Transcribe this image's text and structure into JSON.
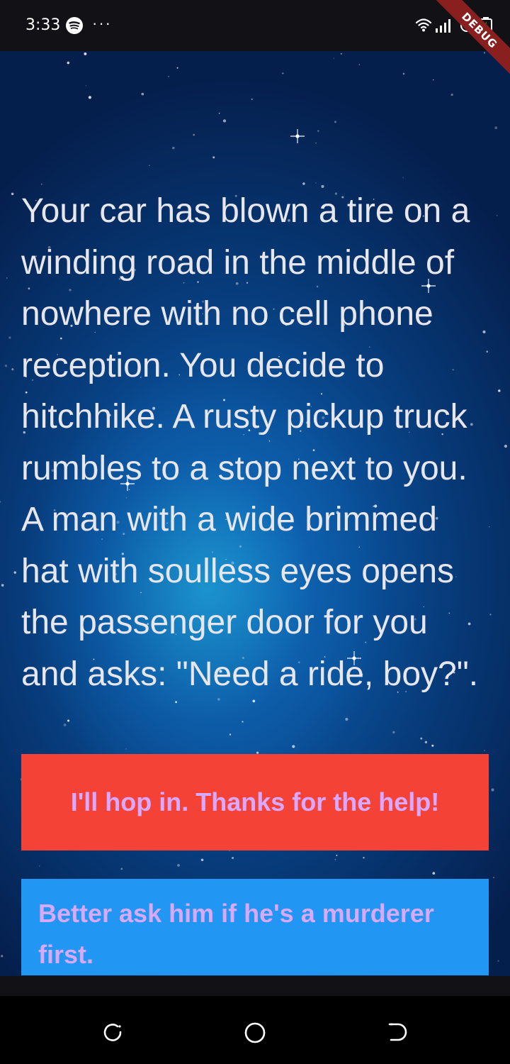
{
  "status_bar": {
    "time": "3:33",
    "icons": [
      "spotify-icon",
      "more-icon",
      "wifi-icon",
      "signal-icon",
      "alarm-icon",
      "battery-icon"
    ],
    "more_glyph": "···"
  },
  "debug_banner": "DEBUG",
  "story": {
    "text": "Your car has blown a tire on a winding road in the middle of nowhere with no cell phone reception. You decide to hitchhike. A rusty pickup truck rumbles to a stop next to you. A man with a wide brimmed hat with soulless eyes opens the passenger door for you and asks: \"Need a ride, boy?\"."
  },
  "choices": [
    {
      "label": "I'll hop in. Thanks for the help!",
      "color": "#f44336"
    },
    {
      "label": "Better ask him if he's a murderer first.",
      "color": "#2196f3"
    }
  ],
  "nav_bar": {
    "icons": [
      "recents-icon",
      "home-icon",
      "back-icon"
    ]
  },
  "colors": {
    "button_text": "#d9a8ff",
    "story_text": "#e6e6ec",
    "debug_ribbon": "#8a1f1f"
  }
}
